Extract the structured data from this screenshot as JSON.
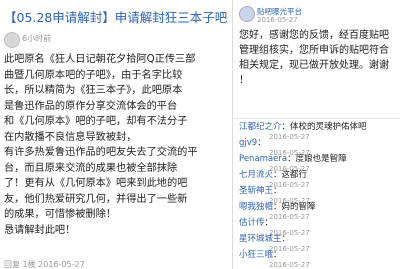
{
  "left": {
    "title": "【05.28申请解封】申请解封狂三本子吧",
    "time": "6小时前",
    "body_lines": [
      "此吧原名《狂人日记朝花夕拾阿Q正传三部",
      "曲暨几何原本吧的子吧》，由于名字比较",
      "长，所以精简为《狂三本子》，此吧原本",
      "是鲁迅作品的原作分享交流体会的平台",
      "和《几何原本》吧的子吧，却有不法分子",
      "在内散播不良信息导致被封，",
      "有许多热爱鲁迅作品的吧友失去了交流的平",
      "台，而且原来交流的成果也被全部抹除",
      "了！更有从《几何原本》吧来到此地的吧",
      "友，他们热爱研究几何，并得出了一些新",
      "的成果，可惜惨被删除！",
      "恳请解封此吧！"
    ],
    "footer": "回复 1楼 2016-05-27"
  },
  "right": {
    "header_name": "贴吧曝光平台",
    "header_date": "2016-05-27",
    "notice_lines": [
      "您好，感谢您的反馈，经百度贴吧",
      "管理组核实，您所申诉的贴吧符合",
      "相关规定，现已做开放处理。谢谢",
      "！"
    ],
    "comments": [
      {
        "user": "江都纪之介",
        "sep": "：",
        "text": "体校的灵魂护佑体吧",
        "date": "2016-05-27"
      },
      {
        "user": "gjv9",
        "sep": "：",
        "text": "",
        "date": "2016-05-27"
      },
      {
        "user": "Penamaera",
        "sep": "：",
        "text": "度娘也是智障",
        "date": "2016-05-27"
      },
      {
        "user": "七月流火",
        "sep": "：",
        "text": "这都行",
        "date": "2016-05-27"
      },
      {
        "user": "圣斩神王",
        "sep": "：",
        "text": "",
        "date": "2016-05-27"
      },
      {
        "user": "嗯我独帽",
        "sep": "：",
        "text": "妈的智障",
        "date": "2016-05-27"
      },
      {
        "user": "估计传",
        "sep": "：",
        "text": "",
        "date": "2016-05-27"
      },
      {
        "user": "星环城城主",
        "sep": "：",
        "text": "",
        "date": "2016-05-27"
      },
      {
        "user": "小狂三哦",
        "sep": "：",
        "text": "",
        "date": "2016-05-27"
      }
    ]
  }
}
